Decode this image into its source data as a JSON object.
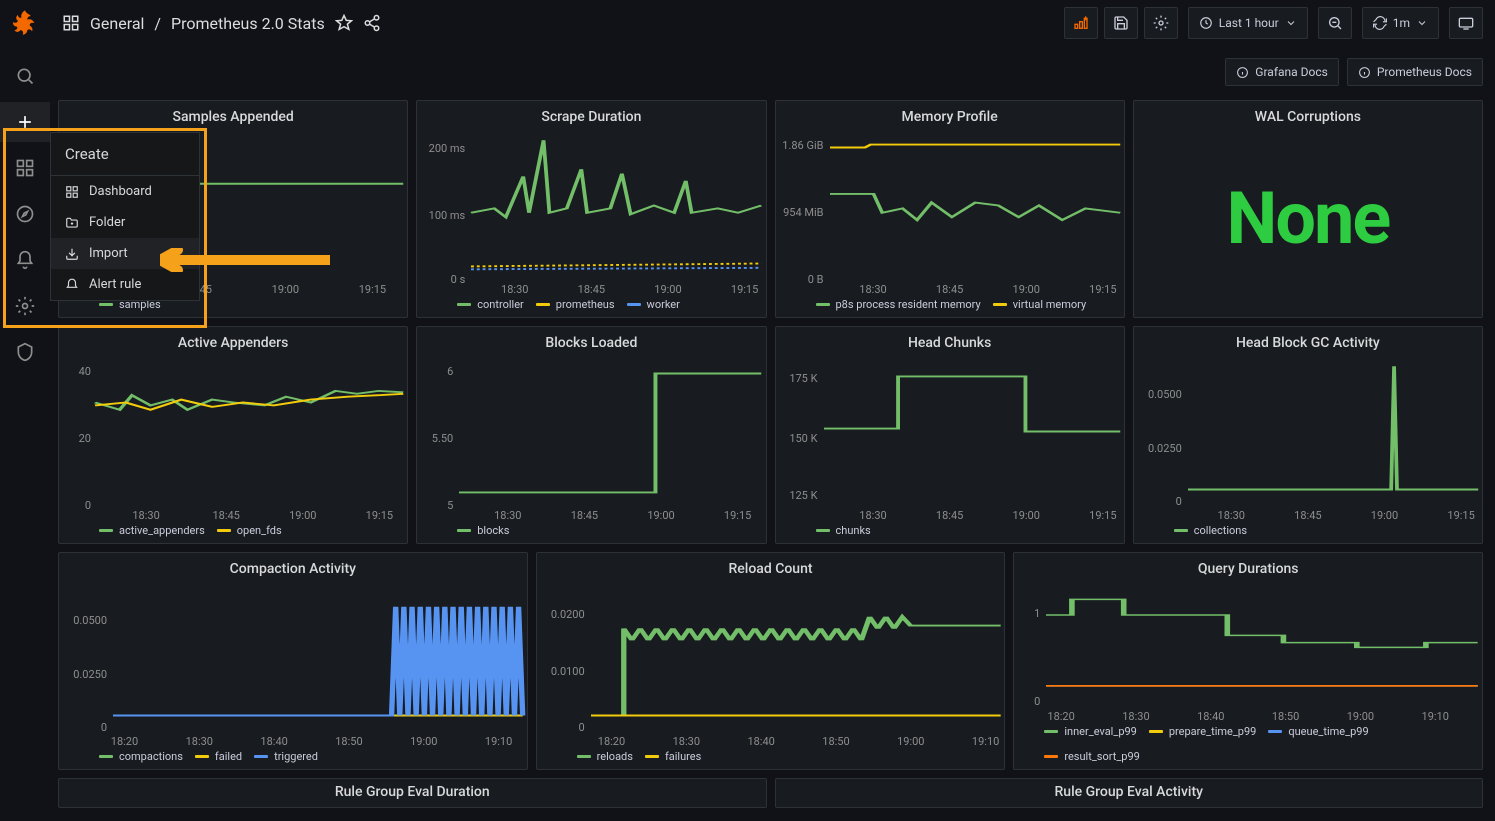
{
  "breadcrumb": {
    "folder": "General",
    "dashboard": "Prometheus 2.0 Stats"
  },
  "topbar": {
    "timerange": "Last 1 hour",
    "refresh": "1m"
  },
  "doclinks": {
    "grafana": "Grafana Docs",
    "prometheus": "Prometheus Docs"
  },
  "flyout": {
    "title": "Create",
    "items": [
      {
        "icon": "dashboard",
        "label": "Dashboard"
      },
      {
        "icon": "folder",
        "label": "Folder"
      },
      {
        "icon": "import",
        "label": "Import"
      },
      {
        "icon": "bell",
        "label": "Alert rule"
      }
    ]
  },
  "panels": {
    "r1": [
      {
        "title": "Samples Appended",
        "legend": [
          {
            "c": "green",
            "t": "samples"
          }
        ]
      },
      {
        "title": "Scrape Duration",
        "legend": [
          {
            "c": "green",
            "t": "controller"
          },
          {
            "c": "yellow",
            "t": "prometheus"
          },
          {
            "c": "blue",
            "t": "worker"
          }
        ]
      },
      {
        "title": "Memory Profile",
        "legend": [
          {
            "c": "green",
            "t": "p8s process resident memory"
          },
          {
            "c": "yellow",
            "t": "virtual memory"
          }
        ]
      },
      {
        "title": "WAL Corruptions",
        "big": "None"
      }
    ],
    "r2": [
      {
        "title": "Active Appenders",
        "legend": [
          {
            "c": "green",
            "t": "active_appenders"
          },
          {
            "c": "yellow",
            "t": "open_fds"
          }
        ]
      },
      {
        "title": "Blocks Loaded",
        "legend": [
          {
            "c": "green",
            "t": "blocks"
          }
        ]
      },
      {
        "title": "Head Chunks",
        "legend": [
          {
            "c": "green",
            "t": "chunks"
          }
        ]
      },
      {
        "title": "Head Block GC Activity",
        "legend": [
          {
            "c": "green",
            "t": "collections"
          }
        ]
      }
    ],
    "r3": [
      {
        "title": "Compaction Activity",
        "legend": [
          {
            "c": "green",
            "t": "compactions"
          },
          {
            "c": "yellow",
            "t": "failed"
          },
          {
            "c": "blue",
            "t": "triggered"
          }
        ]
      },
      {
        "title": "Reload Count",
        "legend": [
          {
            "c": "green",
            "t": "reloads"
          },
          {
            "c": "yellow",
            "t": "failures"
          }
        ]
      },
      {
        "title": "Query Durations",
        "legend": [
          {
            "c": "green",
            "t": "inner_eval_p99"
          },
          {
            "c": "yellow",
            "t": "prepare_time_p99"
          },
          {
            "c": "blue",
            "t": "queue_time_p99"
          },
          {
            "c": "orange",
            "t": "result_sort_p99"
          }
        ]
      }
    ],
    "r4": [
      {
        "title": "Rule Group Eval Duration"
      },
      {
        "title": "Rule Group Eval Activity"
      }
    ]
  },
  "axes": {
    "time4": [
      "18:30",
      "18:45",
      "19:00",
      "19:15"
    ],
    "time5": [
      "18:20",
      "18:30",
      "18:40",
      "18:50",
      "19:00",
      "19:10"
    ],
    "time5b": [
      "18:20",
      "18:30",
      "18:40",
      "18:50",
      "19:00",
      "19:10"
    ],
    "scrape_y": [
      "200 ms",
      "100 ms",
      "0 s"
    ],
    "memory_y": [
      "1.86 GiB",
      "954 MiB",
      "0 B"
    ],
    "appenders_y": [
      "40",
      "20",
      "0"
    ],
    "blocks_y": [
      "6",
      "5.50",
      "5"
    ],
    "chunks_y": [
      "175 K",
      "150 K",
      "125 K"
    ],
    "gc_y": [
      "0.0500",
      "0.0250",
      "0"
    ],
    "compact_y": [
      "0.0500",
      "0.0250",
      "0"
    ],
    "reload_y": [
      "0.0200",
      "0.0100",
      "0"
    ],
    "query_y": [
      "1",
      "0"
    ]
  },
  "chart_data": [
    {
      "type": "line",
      "title": "Samples Appended",
      "series": [
        {
          "name": "samples",
          "values": "flat"
        }
      ],
      "x": [
        "18:30",
        "18:45",
        "19:00",
        "19:15"
      ]
    },
    {
      "type": "line",
      "title": "Scrape Duration",
      "ylim": [
        "0 s",
        "200 ms"
      ],
      "series": [
        {
          "name": "controller",
          "values": "spiky 80-200ms"
        },
        {
          "name": "prometheus",
          "values": "noisy ~10ms"
        },
        {
          "name": "worker",
          "values": "noisy ~10ms"
        }
      ],
      "x": [
        "18:30",
        "18:45",
        "19:00",
        "19:15"
      ]
    },
    {
      "type": "line",
      "title": "Memory Profile",
      "ylim": [
        "0 B",
        "1.86 GiB"
      ],
      "series": [
        {
          "name": "p8s process resident memory",
          "values": "~954 MiB wandering"
        },
        {
          "name": "virtual memory",
          "values": "flat 1.86 GiB"
        }
      ],
      "x": [
        "18:30",
        "18:45",
        "19:00",
        "19:15"
      ]
    },
    {
      "type": "stat",
      "title": "WAL Corruptions",
      "value": "None"
    },
    {
      "type": "line",
      "title": "Active Appenders",
      "ylim": [
        0,
        40
      ],
      "series": [
        {
          "name": "active_appenders",
          "values": "~30 noisy"
        },
        {
          "name": "open_fds",
          "values": "~30 noisy"
        }
      ],
      "x": [
        "18:30",
        "18:45",
        "19:00",
        "19:15"
      ]
    },
    {
      "type": "line",
      "title": "Blocks Loaded",
      "ylim": [
        5,
        6
      ],
      "series": [
        {
          "name": "blocks",
          "values": [
            5,
            5,
            6,
            6
          ]
        }
      ],
      "x": [
        "18:30",
        "18:45",
        "19:00",
        "19:15"
      ]
    },
    {
      "type": "line",
      "title": "Head Chunks",
      "ylim": [
        "125 K",
        "175 K"
      ],
      "series": [
        {
          "name": "chunks",
          "values": [
            "150K",
            "150K",
            "175K",
            "175K",
            "150K"
          ]
        }
      ],
      "x": [
        "18:30",
        "18:45",
        "19:00",
        "19:15"
      ]
    },
    {
      "type": "line",
      "title": "Head Block GC Activity",
      "ylim": [
        0,
        0.05
      ],
      "series": [
        {
          "name": "collections",
          "values": "single spike near 19:00"
        }
      ],
      "x": [
        "18:30",
        "18:45",
        "19:00",
        "19:15"
      ]
    },
    {
      "type": "line",
      "title": "Compaction Activity",
      "ylim": [
        0,
        0.05
      ],
      "series": [
        {
          "name": "compactions"
        },
        {
          "name": "failed"
        },
        {
          "name": "triggered",
          "values": "dense oscillation after 18:55"
        }
      ],
      "x": [
        "18:20",
        "18:30",
        "18:40",
        "18:50",
        "19:00",
        "19:10"
      ]
    },
    {
      "type": "line",
      "title": "Reload Count",
      "ylim": [
        0,
        0.02
      ],
      "series": [
        {
          "name": "reloads",
          "values": "sawtooth ~0.016"
        },
        {
          "name": "failures",
          "values": 0
        }
      ],
      "x": [
        "18:20",
        "18:30",
        "18:40",
        "18:50",
        "19:00",
        "19:10"
      ]
    },
    {
      "type": "line",
      "title": "Query Durations",
      "ylim": [
        0,
        1
      ],
      "series": [
        {
          "name": "inner_eval_p99",
          "values": "step-down 1→0.4"
        },
        {
          "name": "prepare_time_p99"
        },
        {
          "name": "queue_time_p99"
        },
        {
          "name": "result_sort_p99"
        }
      ],
      "x": [
        "18:20",
        "18:30",
        "18:40",
        "18:50",
        "19:00",
        "19:10"
      ]
    }
  ]
}
